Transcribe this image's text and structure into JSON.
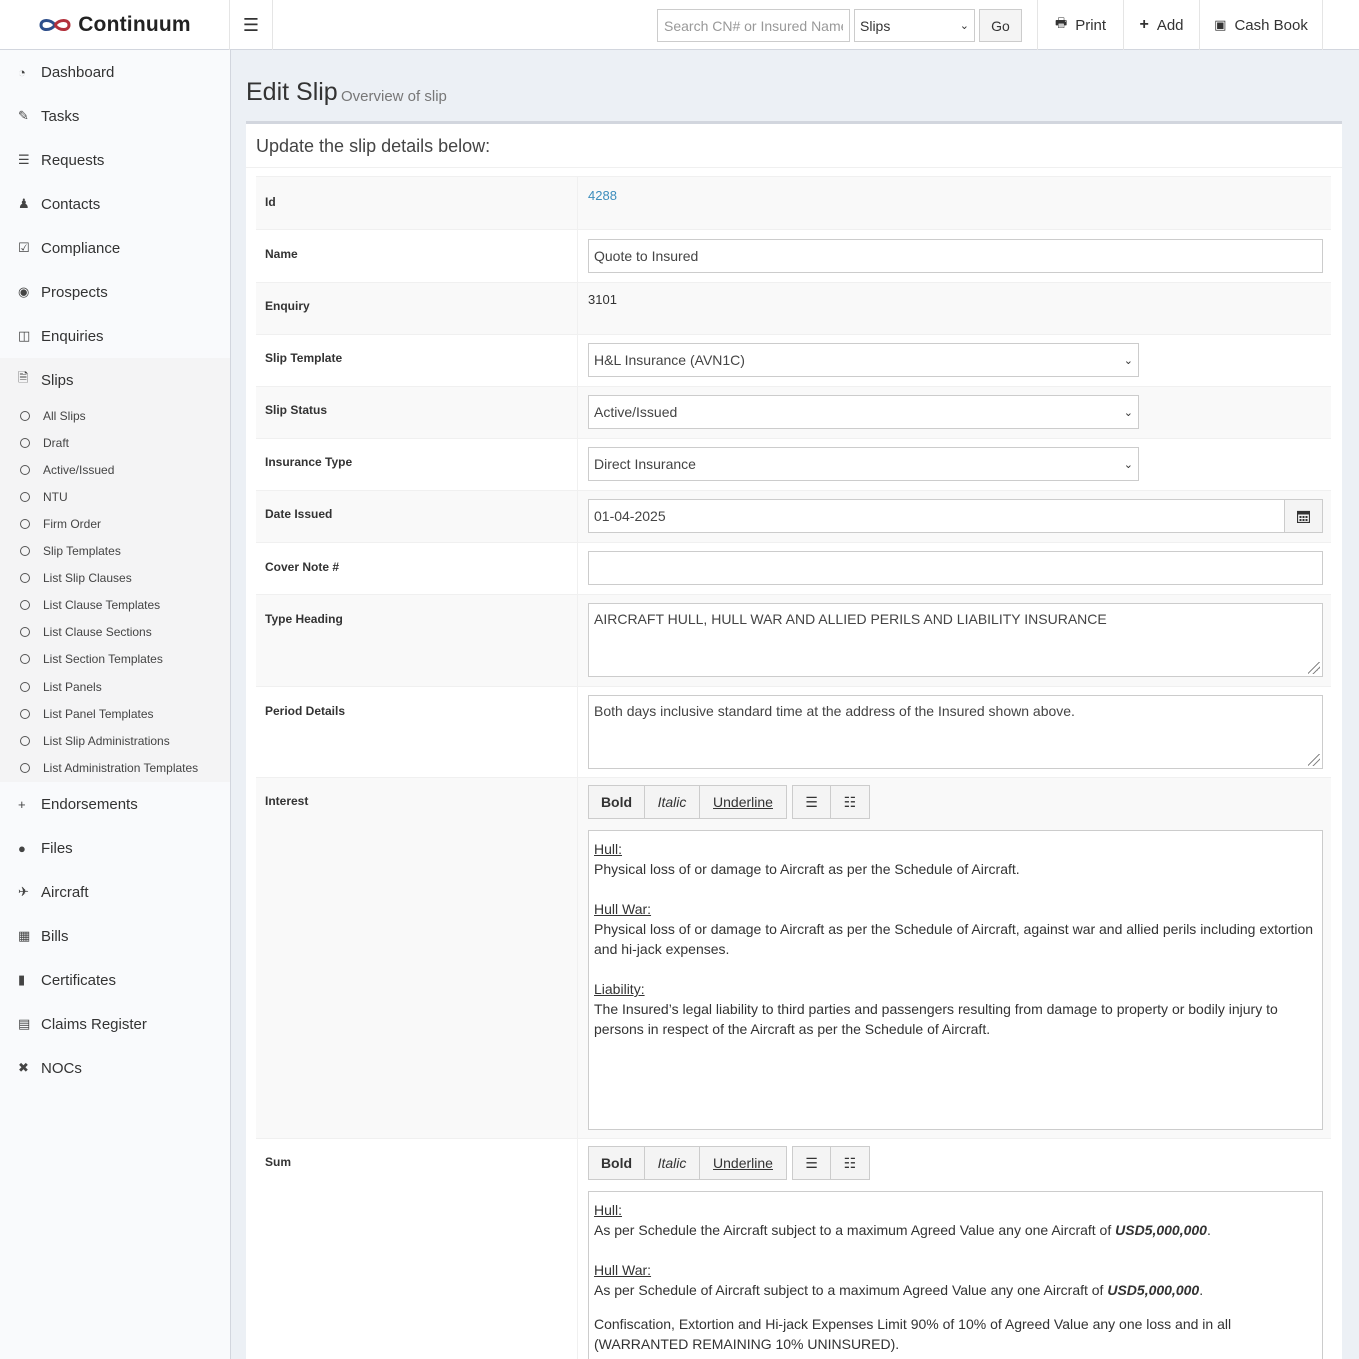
{
  "app": {
    "name": "Continuum",
    "search_placeholder": "Search CN# or Insured Name",
    "search_type": "Slips",
    "go_label": "Go",
    "print_label": "Print",
    "add_label": "Add",
    "cashbook_label": "Cash Book"
  },
  "sidebar": {
    "items": [
      {
        "label": "Dashboard",
        "icon": "dashboard-icon"
      },
      {
        "label": "Tasks",
        "icon": "pencil-icon"
      },
      {
        "label": "Requests",
        "icon": "list-icon"
      },
      {
        "label": "Contacts",
        "icon": "users-icon"
      },
      {
        "label": "Compliance",
        "icon": "check-square-icon"
      },
      {
        "label": "Prospects",
        "icon": "binoculars-icon"
      },
      {
        "label": "Enquiries",
        "icon": "inbox-icon"
      },
      {
        "label": "Slips",
        "icon": "file-icon"
      },
      {
        "label": "Endorsements",
        "icon": "plus-icon"
      },
      {
        "label": "Files",
        "icon": "globe-icon"
      },
      {
        "label": "Aircraft",
        "icon": "plane-icon"
      },
      {
        "label": "Bills",
        "icon": "calculator-icon"
      },
      {
        "label": "Certificates",
        "icon": "bookmark-icon"
      },
      {
        "label": "Claims Register",
        "icon": "medkit-icon"
      },
      {
        "label": "NOCs",
        "icon": "times-icon"
      }
    ],
    "slips_sub": [
      "All Slips",
      "Draft",
      "Active/Issued",
      "NTU",
      "Firm Order",
      "Slip Templates",
      "List Slip Clauses",
      "List Clause Templates",
      "List Clause Sections",
      "List Section Templates",
      "List Panels",
      "List Panel Templates",
      "List Slip Administrations",
      "List Administration Templates"
    ]
  },
  "page": {
    "title": "Edit Slip",
    "subtitle": "Overview of slip",
    "box_title": "Update the slip details below:"
  },
  "form": {
    "id_label": "Id",
    "id_value": "4288",
    "name_label": "Name",
    "name_value": "Quote to Insured",
    "enquiry_label": "Enquiry",
    "enquiry_value": "3101",
    "template_label": "Slip Template",
    "template_value": "H&L Insurance (AVN1C)",
    "status_label": "Slip Status",
    "status_value": "Active/Issued",
    "type_label": "Insurance Type",
    "type_value": "Direct Insurance",
    "date_label": "Date Issued",
    "date_value": "01-04-2025",
    "cover_label": "Cover Note #",
    "cover_value": "",
    "heading_label": "Type Heading",
    "heading_value": "AIRCRAFT HULL, HULL WAR AND ALLIED PERILS AND LIABILITY INSURANCE",
    "period_label": "Period Details",
    "period_value": "Both days inclusive standard time at the address of the Insured shown above.",
    "interest_label": "Interest",
    "sum_label": "Sum"
  },
  "toolbar": {
    "bold": "Bold",
    "italic": "Italic",
    "underline": "Underline"
  },
  "interest": {
    "hull_h": "Hull:",
    "hull_t": "Physical loss of or damage to Aircraft as per the Schedule of Aircraft.",
    "war_h": "Hull War:",
    "war_t": "Physical loss of or damage to Aircraft as per the Schedule of Aircraft, against war and allied perils including extortion and hi-jack expenses.",
    "liab_h": "Liability:",
    "liab_t": "The Insured’s legal liability to third parties and passengers resulting from damage to property or bodily injury to persons in respect of the Aircraft as per the Schedule of Aircraft."
  },
  "sum": {
    "hull_h": "Hull:",
    "hull_t": "As per Schedule the Aircraft subject to a maximum Agreed Value any one Aircraft of",
    "hull_v": "USD5,000,000",
    "war_h": "Hull War:",
    "war_t": "As per Schedule of Aircraft subject to a maximum Agreed Value any one Aircraft of",
    "war_v": "USD5,000,000",
    "conf_t": "Confiscation, Extortion and Hi-jack Expenses Limit 90% of 10% of Agreed Value any one loss and in all (WARRANTED REMAINING 10% UNINSURED).",
    "period": "."
  },
  "colors": {
    "link": "#3c8dbc",
    "brand_blue": "#2d4e8a",
    "brand_red": "#b2303b"
  }
}
